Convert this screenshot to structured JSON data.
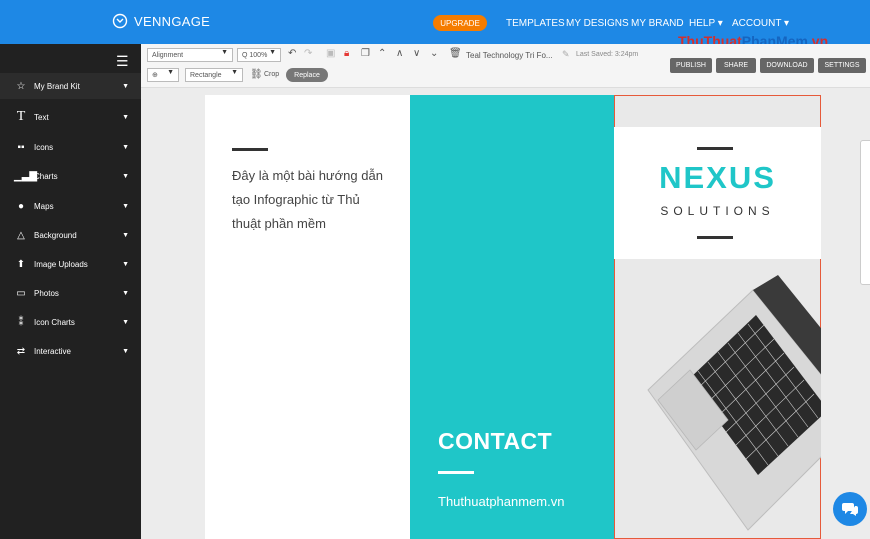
{
  "app": {
    "logo_text": "VENNGAGE"
  },
  "header": {
    "upgrade_label": "UPGRADE",
    "nav": [
      "TEMPLATES",
      "MY DESIGNS",
      "MY BRAND",
      "HELP ▾",
      "ACCOUNT ▾"
    ],
    "watermark_part1": "ThuThuat",
    "watermark_part2": "PhanMem",
    "watermark_part3": ".vn"
  },
  "toolbar": {
    "alignment_label": "Alignment",
    "zoom_label": "Q 100%",
    "shape_label": "Rectangle",
    "crop_label": "Crop",
    "replace_label": "Replace",
    "doc_name": "Teal Technology Tri Fo...",
    "last_saved": "Last Saved: 3:24pm",
    "buttons": {
      "publish": "PUBLISH",
      "share": "SHARE",
      "download": "DOWNLOAD",
      "settings": "SETTINGS"
    }
  },
  "sidebar": {
    "items": [
      {
        "label": "My Brand Kit",
        "icon": "star-icon"
      },
      {
        "label": "Text",
        "icon": "text-icon"
      },
      {
        "label": "Icons",
        "icon": "icons-icon"
      },
      {
        "label": "Charts",
        "icon": "chart-icon"
      },
      {
        "label": "Maps",
        "icon": "globe-icon"
      },
      {
        "label": "Background",
        "icon": "background-icon"
      },
      {
        "label": "Image Uploads",
        "icon": "upload-icon"
      },
      {
        "label": "Photos",
        "icon": "photo-icon"
      },
      {
        "label": "Icon Charts",
        "icon": "icon-chart-icon"
      },
      {
        "label": "Interactive",
        "icon": "interactive-icon"
      }
    ]
  },
  "canvas": {
    "body_text": "Đây là một bài hướng dẫn tạo Infographic từ Thủ thuật phần mềm",
    "contact_title": "CONTACT",
    "website": "Thuthuatphanmem.vn",
    "brand_name": "NEXUS",
    "brand_sub": "SOLUTIONS"
  },
  "colors": {
    "accent": "#1e88e5",
    "teal": "#1fc6c8",
    "upgrade": "#f57c00",
    "sidebar": "#212121"
  }
}
